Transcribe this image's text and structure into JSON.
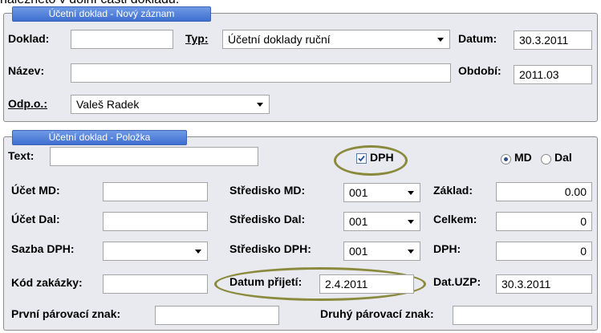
{
  "top_text": "nalezneto v dolní části dokladu.",
  "header_section": {
    "legend": "Účetní doklad - Nový záznam",
    "doklad_label": "Doklad:",
    "doklad_value": "",
    "typ_label": "Typ:",
    "typ_value": "Účetní doklady ruční",
    "datum_label": "Datum:",
    "datum_value": "30.3.2011",
    "nazev_label": "Název:",
    "nazev_value": "",
    "obdobi_label": "Období:",
    "obdobi_value": "2011.03",
    "odpo_label": "Odp.o.:",
    "odpo_value": "Valeš Radek"
  },
  "item_section": {
    "legend": "Účetní doklad - Položka",
    "text_label": "Text:",
    "text_value": "",
    "dph_checkbox_label": "DPH",
    "dph_checked": true,
    "md_label": "MD",
    "dal_label": "Dal",
    "selected_side": "MD",
    "ucet_md_label": "Účet MD:",
    "ucet_md_value": "",
    "ucet_dal_label": "Účet Dal:",
    "ucet_dal_value": "",
    "sazba_dph_label": "Sazba DPH:",
    "sazba_dph_value": "",
    "kod_zakazky_label": "Kód zakázky:",
    "kod_zakazky_value": "",
    "prvni_parovaci_label": "První párovací znak:",
    "prvni_parovaci_value": "",
    "stredisko_md_label": "Středisko MD:",
    "stredisko_md_value": "001",
    "stredisko_dal_label": "Středisko Dal:",
    "stredisko_dal_value": "001",
    "stredisko_dph_label": "Středisko DPH:",
    "stredisko_dph_value": "001",
    "datum_prijeti_label": "Datum přijetí:",
    "datum_prijeti_value": "2.4.2011",
    "druhy_parovaci_label": "Druhý párovací znak:",
    "druhy_parovaci_value": "",
    "zaklad_label": "Základ:",
    "zaklad_value": "0.00",
    "celkem_label": "Celkem:",
    "celkem_value": "0",
    "dph_label": "DPH:",
    "dph_value": "0",
    "dat_uzp_label": "Dat.UZP:",
    "dat_uzp_value": "30.3.2011"
  },
  "colors": {
    "panel_bg": "#e9eaf0",
    "legend_bg": "#4a7bd8",
    "highlight_ellipse": "#8b8a3c"
  }
}
